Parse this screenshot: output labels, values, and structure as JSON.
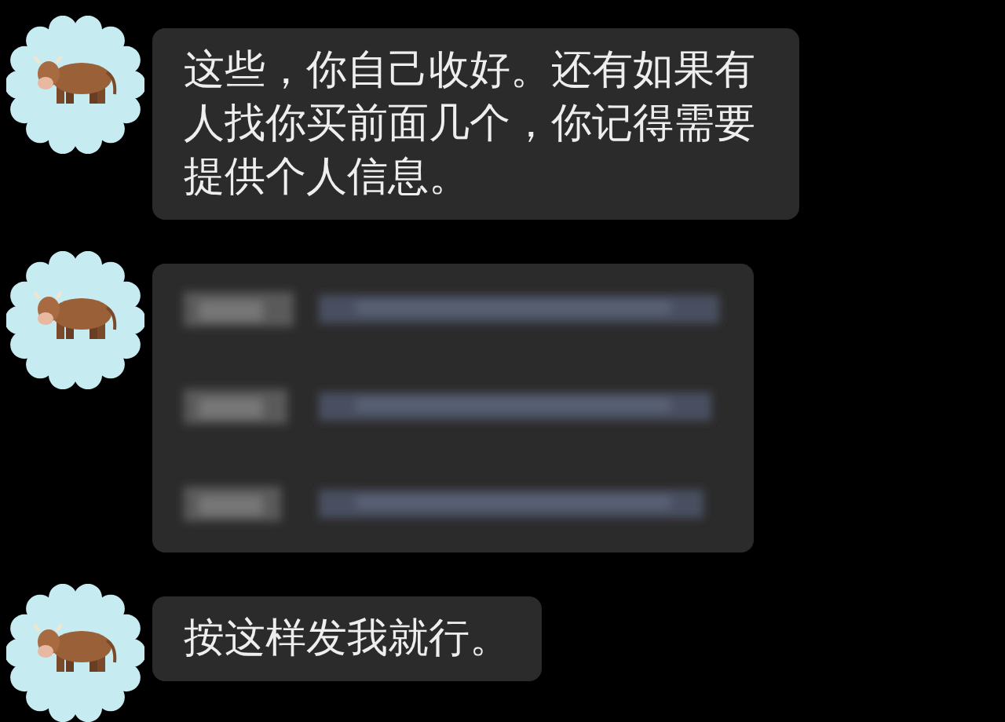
{
  "messages": [
    {
      "kind": "text",
      "text": "这些，你自己收好。还有如果有人找你买前面几个，你记得需要提供个人信息。"
    },
    {
      "kind": "redacted"
    },
    {
      "kind": "text",
      "text": "按这样发我就行。"
    }
  ]
}
